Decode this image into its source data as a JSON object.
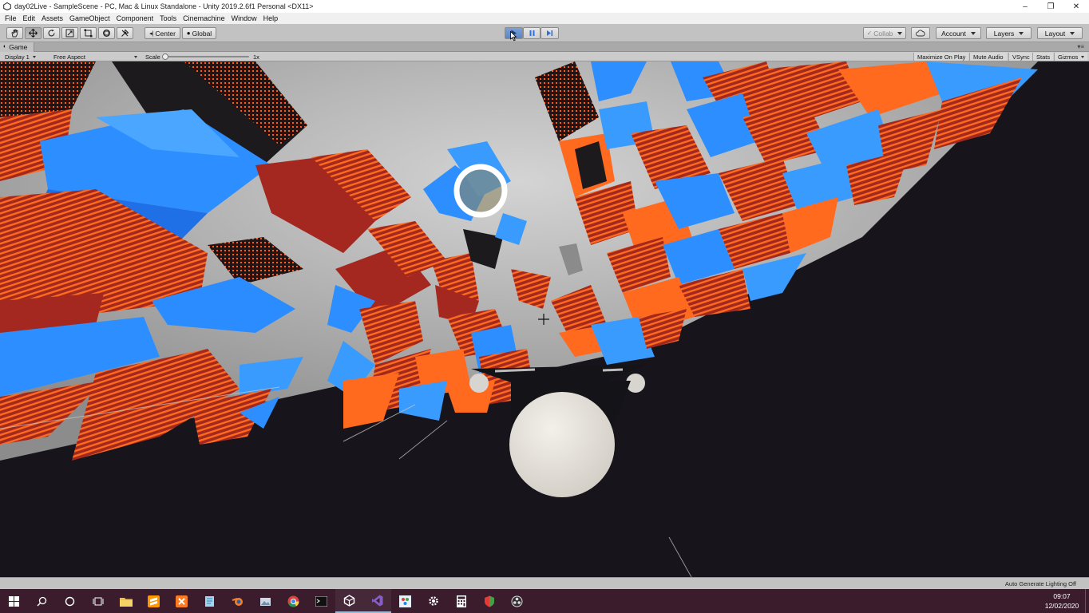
{
  "window": {
    "title": "day02Live - SampleScene - PC, Mac & Linux Standalone - Unity 2019.2.6f1 Personal <DX11>",
    "controls": [
      "–",
      "❐",
      "✕"
    ]
  },
  "menu": [
    "File",
    "Edit",
    "Assets",
    "GameObject",
    "Component",
    "Tools",
    "Cinemachine",
    "Window",
    "Help"
  ],
  "toolbar": {
    "tools": [
      "hand-tool",
      "move-tool",
      "rotate-tool",
      "scale-tool",
      "rect-tool",
      "transform-tool",
      "custom-tool"
    ],
    "pivot_label": "Center",
    "space_label": "Global",
    "collab_label": "Collab",
    "account_label": "Account",
    "layers_label": "Layers",
    "layout_label": "Layout"
  },
  "game_tab": {
    "label": "Game",
    "display": "Display 1",
    "aspect": "Free Aspect",
    "scale_label": "Scale",
    "scale_value": "1x",
    "maximize_on_play": "Maximize On Play",
    "mute_audio": "Mute Audio",
    "vsync": "VSync",
    "stats": "Stats",
    "gizmos": "Gizmos"
  },
  "status": {
    "lighting": "Auto Generate Lighting Off"
  },
  "taskbar": {
    "apps": [
      "start",
      "search",
      "cortana",
      "task-view",
      "file-explorer",
      "sublime-text",
      "xampp",
      "notepad",
      "blender",
      "photos",
      "chrome",
      "terminal",
      "unity",
      "visual-studio",
      "paint",
      "settings",
      "calculator",
      "shield",
      "obs"
    ],
    "time": "09:07",
    "date": "12/02/2020"
  },
  "colors": {
    "orange": "#ff6a1f",
    "blue": "#2e8dff",
    "red": "#a72a22",
    "sky": "#a9a9a9",
    "ground": "#17151b"
  }
}
